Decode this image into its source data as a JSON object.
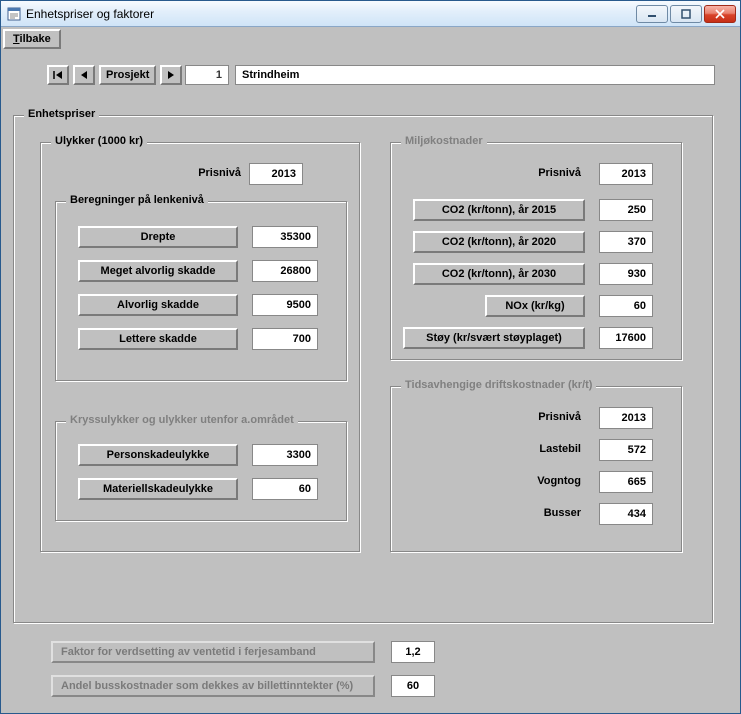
{
  "window": {
    "title": "Enhetspriser og faktorer"
  },
  "menu": {
    "back": "Tilbake",
    "back_prefix": "T",
    "back_rest": "ilbake"
  },
  "nav": {
    "prosjekt_label": "Prosjekt",
    "number": "1",
    "name": "Strindheim"
  },
  "main_group": {
    "title": "Enhetspriser"
  },
  "ulykker": {
    "title": "Ulykker (1000 kr)",
    "prisniva_label": "Prisnivå",
    "prisniva_value": "2013",
    "beregn_title": "Beregninger på lenkenivå",
    "drepte_label": "Drepte",
    "drepte_value": "35300",
    "meget_label": "Meget alvorlig skadde",
    "meget_value": "26800",
    "alvorlig_label": "Alvorlig skadde",
    "alvorlig_value": "9500",
    "lettere_label": "Lettere skadde",
    "lettere_value": "700",
    "kryss_title": "Kryssulykker og ulykker utenfor a.området",
    "person_label": "Personskadeulykke",
    "person_value": "3300",
    "materiell_label": "Materiellskadeulykke",
    "materiell_value": "60"
  },
  "miljo": {
    "title": "Miljøkostnader",
    "prisniva_label": "Prisnivå",
    "prisniva_value": "2013",
    "co2_2015_label": "CO2 (kr/tonn), år 2015",
    "co2_2015_value": "250",
    "co2_2020_label": "CO2 (kr/tonn), år 2020",
    "co2_2020_value": "370",
    "co2_2030_label": "CO2 (kr/tonn), år 2030",
    "co2_2030_value": "930",
    "nox_label": "NOx (kr/kg)",
    "nox_value": "60",
    "stoy_label": "Støy (kr/svært støyplaget)",
    "stoy_value": "17600"
  },
  "drift": {
    "title": "Tidsavhengige driftskostnader (kr/t)",
    "prisniva_label": "Prisnivå",
    "prisniva_value": "2013",
    "lastebil_label": "Lastebil",
    "lastebil_value": "572",
    "vogntog_label": "Vogntog",
    "vogntog_value": "665",
    "busser_label": "Busser",
    "busser_value": "434"
  },
  "bottom": {
    "faktor_label": "Faktor for verdsetting av ventetid i ferjesamband",
    "faktor_value": "1,2",
    "andel_label": "Andel busskostnader som dekkes av billettinntekter (%)",
    "andel_value": "60"
  }
}
